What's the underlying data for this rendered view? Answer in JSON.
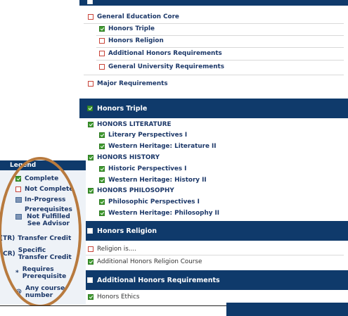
{
  "colors": {
    "navy": "#0f3a6b",
    "green": "#3f9b2f",
    "red": "#c8443a",
    "oval": "#b87a3e"
  },
  "main": {
    "top_items": [
      {
        "label": "General Education Core",
        "status": "not-complete"
      },
      {
        "label": "Honors Triple",
        "status": "complete"
      },
      {
        "label": "Honors Religion",
        "status": "not-complete"
      },
      {
        "label": "Additional Honors Requirements",
        "status": "not-complete"
      },
      {
        "label": "General University Requirements",
        "status": "not-complete"
      },
      {
        "label": "Major Requirements",
        "status": "not-complete"
      }
    ],
    "honors_triple": {
      "title": "Honors Triple",
      "items": [
        {
          "label": "HONORS LITERATURE",
          "indent": 0
        },
        {
          "label": "Literary Perspectives I",
          "indent": 1
        },
        {
          "label": "Western Heritage: Literature II",
          "indent": 1
        },
        {
          "label": "HONORS HISTORY",
          "indent": 0
        },
        {
          "label": "Historic Perspectives I",
          "indent": 1
        },
        {
          "label": "Western Heritage: History II",
          "indent": 1
        },
        {
          "label": "HONORS PHILOSOPHY",
          "indent": 0
        },
        {
          "label": "Philosophic Perspectives I",
          "indent": 1
        },
        {
          "label": "Western Heritage: Philosophy II",
          "indent": 1
        }
      ]
    },
    "honors_religion": {
      "title": "Honors Religion",
      "items": [
        {
          "label": "Religion is....",
          "status": "not-complete"
        },
        {
          "label": "Additional Honors Religion Course",
          "status": "complete"
        }
      ]
    },
    "additional_honors": {
      "title": "Additional Honors Requirements",
      "items": [
        {
          "label": "Honors Ethics",
          "status": "complete"
        }
      ]
    }
  },
  "legend": {
    "title": "Legend",
    "complete": "Complete",
    "not_complete": "Not Complete",
    "in_progress": "In-Progress",
    "prereq_line1": "Prerequisites",
    "prereq_line2": "Not Fulfilled",
    "prereq_line3": "See Advisor",
    "tr_tag": "(TR)",
    "tr_label": "Transfer Credit",
    "cr_tag": "(CR)",
    "cr_line1": "Specific",
    "cr_line2": "Transfer Credit",
    "requires_marker": "*",
    "requires_line1": "Requires",
    "requires_line2": "Prerequisite",
    "any_marker": "@",
    "any_line1": "Any course",
    "any_line2": "number"
  }
}
